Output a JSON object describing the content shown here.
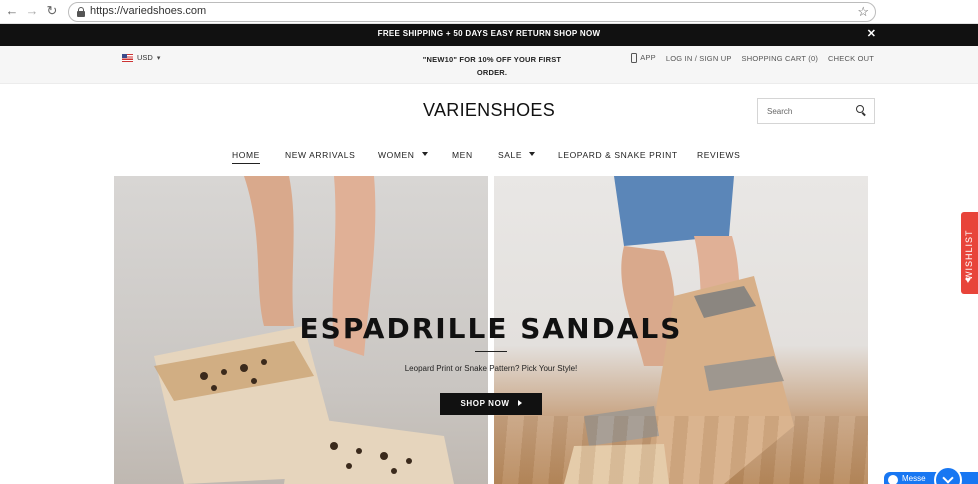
{
  "browser": {
    "url": "https://variedshoes.com"
  },
  "announcement": {
    "text": "FREE SHIPPING + 50 DAYS EASY RETURN SHOP NOW",
    "close_symbol": "✕"
  },
  "utility_bar": {
    "currency": "USD",
    "promo": "\"NEW10\" FOR 10% OFF YOUR FIRST ORDER.",
    "links": {
      "app": "APP",
      "login": "LOG IN / SIGN UP",
      "cart": "SHOPPING CART (0)",
      "checkout": "CHECK OUT"
    }
  },
  "header": {
    "logo": "VARIENSHOES",
    "search_placeholder": "Search"
  },
  "nav": {
    "items": [
      {
        "label": "HOME",
        "active": true
      },
      {
        "label": "NEW ARRIVALS"
      },
      {
        "label": "WOMEN",
        "dropdown": true
      },
      {
        "label": "MEN"
      },
      {
        "label": "SALE",
        "dropdown": true
      },
      {
        "label": "LEOPARD & SNAKE PRINT"
      },
      {
        "label": "REVIEWS"
      }
    ]
  },
  "hero": {
    "title": "ESPADRILLE SANDALS",
    "subtitle": "Leopard Print or Snake Pattern? Pick Your Style!",
    "cta": "SHOP NOW"
  },
  "wishlist": {
    "label": "WISHLIST"
  },
  "messenger": {
    "label": "Messe"
  },
  "colors": {
    "announcement_bg": "#111111",
    "wishlist_bg": "#e8443a",
    "messenger_bg": "#1877f2",
    "cta_bg": "#111111"
  }
}
